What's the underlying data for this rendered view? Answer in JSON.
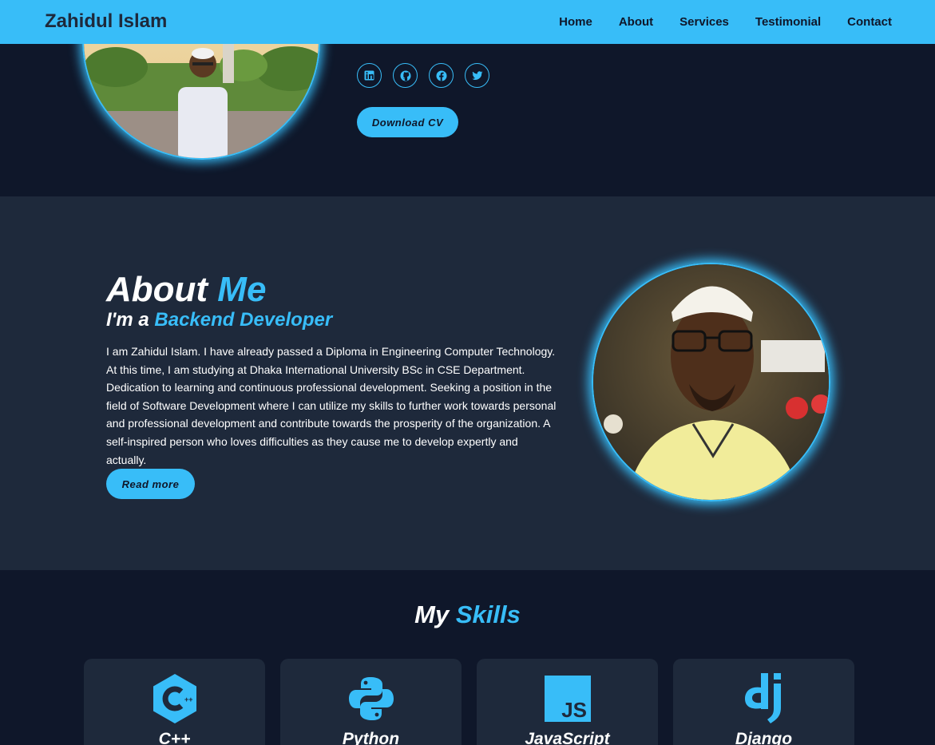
{
  "header": {
    "logo": "Zahidul Islam",
    "nav": [
      "Home",
      "About",
      "Services",
      "Testimonial",
      "Contact"
    ]
  },
  "hero": {
    "socials": [
      "linkedin-icon",
      "github-icon",
      "facebook-icon",
      "twitter-icon"
    ],
    "cv_button": "Download CV"
  },
  "about": {
    "title_a": "About ",
    "title_b": "Me",
    "sub_a": "I'm a ",
    "sub_b": "Backend Developer",
    "text": "I am Zahidul Islam. I have already passed a Diploma in Engineering Computer Technology. At this time, I am studying at Dhaka International University BSc in CSE Department. Dedication to learning and continuous professional development. Seeking a position in the field of Software Development where I can utilize my skills to further work towards personal and professional development and contribute towards the prosperity of the organization. A self-inspired person who loves difficulties as they cause me to develop expertly and actually.",
    "read_more": "Read more"
  },
  "skills": {
    "title_a": "My ",
    "title_b": "Skills",
    "items": [
      {
        "name": "C++",
        "icon": "cplusplus-icon"
      },
      {
        "name": "Python",
        "icon": "python-icon"
      },
      {
        "name": "JavaScript",
        "icon": "javascript-icon"
      },
      {
        "name": "Django",
        "icon": "django-icon"
      }
    ]
  },
  "colors": {
    "accent": "#38bdf8",
    "dark_bg": "#0f172a",
    "section_bg": "#1e293b"
  }
}
